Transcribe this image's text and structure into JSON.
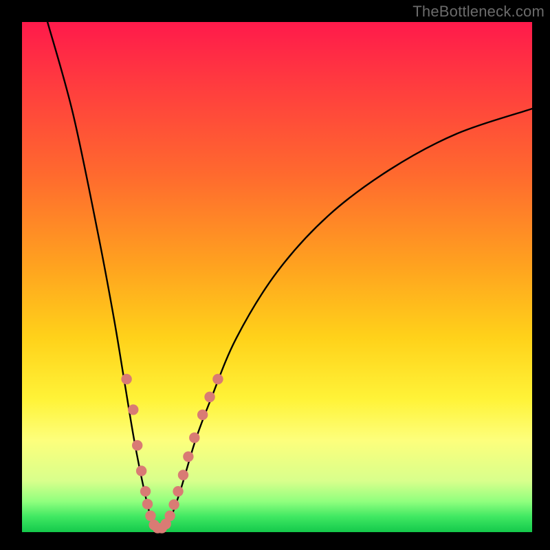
{
  "watermark": "TheBottleneck.com",
  "colors": {
    "page_bg": "#000000",
    "curve": "#000000",
    "marker": "#d97b74",
    "gradient_stops": [
      "#ff1a4b",
      "#ff3b3f",
      "#ff6a2e",
      "#ffa31f",
      "#ffd21a",
      "#fff338",
      "#fdff7c",
      "#d8ff8c",
      "#90ff7e",
      "#3fe862",
      "#14c94b"
    ]
  },
  "chart_data": {
    "type": "line",
    "title": "",
    "xlabel": "",
    "ylabel": "",
    "xlim": [
      0,
      100
    ],
    "ylim": [
      0,
      100
    ],
    "grid": false,
    "legend": false,
    "curve_points": [
      {
        "x": 5,
        "y": 100
      },
      {
        "x": 10,
        "y": 82
      },
      {
        "x": 15,
        "y": 58
      },
      {
        "x": 18,
        "y": 42
      },
      {
        "x": 20,
        "y": 30
      },
      {
        "x": 22,
        "y": 18
      },
      {
        "x": 24,
        "y": 8
      },
      {
        "x": 25.5,
        "y": 2
      },
      {
        "x": 26.5,
        "y": 0.5
      },
      {
        "x": 27.5,
        "y": 0.5
      },
      {
        "x": 29,
        "y": 2.5
      },
      {
        "x": 31,
        "y": 8
      },
      {
        "x": 34,
        "y": 18
      },
      {
        "x": 37,
        "y": 26
      },
      {
        "x": 42,
        "y": 38
      },
      {
        "x": 50,
        "y": 51
      },
      {
        "x": 60,
        "y": 62
      },
      {
        "x": 72,
        "y": 71
      },
      {
        "x": 85,
        "y": 78
      },
      {
        "x": 100,
        "y": 83
      }
    ],
    "markers": [
      {
        "x": 20.5,
        "y": 30
      },
      {
        "x": 21.8,
        "y": 24
      },
      {
        "x": 22.6,
        "y": 17
      },
      {
        "x": 23.4,
        "y": 12
      },
      {
        "x": 24.2,
        "y": 8
      },
      {
        "x": 24.6,
        "y": 5.5
      },
      {
        "x": 25.2,
        "y": 3.2
      },
      {
        "x": 25.9,
        "y": 1.4
      },
      {
        "x": 26.6,
        "y": 0.8
      },
      {
        "x": 27.4,
        "y": 0.8
      },
      {
        "x": 28.2,
        "y": 1.6
      },
      {
        "x": 29.0,
        "y": 3.2
      },
      {
        "x": 29.8,
        "y": 5.4
      },
      {
        "x": 30.6,
        "y": 8.0
      },
      {
        "x": 31.6,
        "y": 11.2
      },
      {
        "x": 32.6,
        "y": 14.8
      },
      {
        "x": 33.8,
        "y": 18.5
      },
      {
        "x": 35.4,
        "y": 23.0
      },
      {
        "x": 36.8,
        "y": 26.5
      },
      {
        "x": 38.4,
        "y": 30.0
      }
    ]
  }
}
